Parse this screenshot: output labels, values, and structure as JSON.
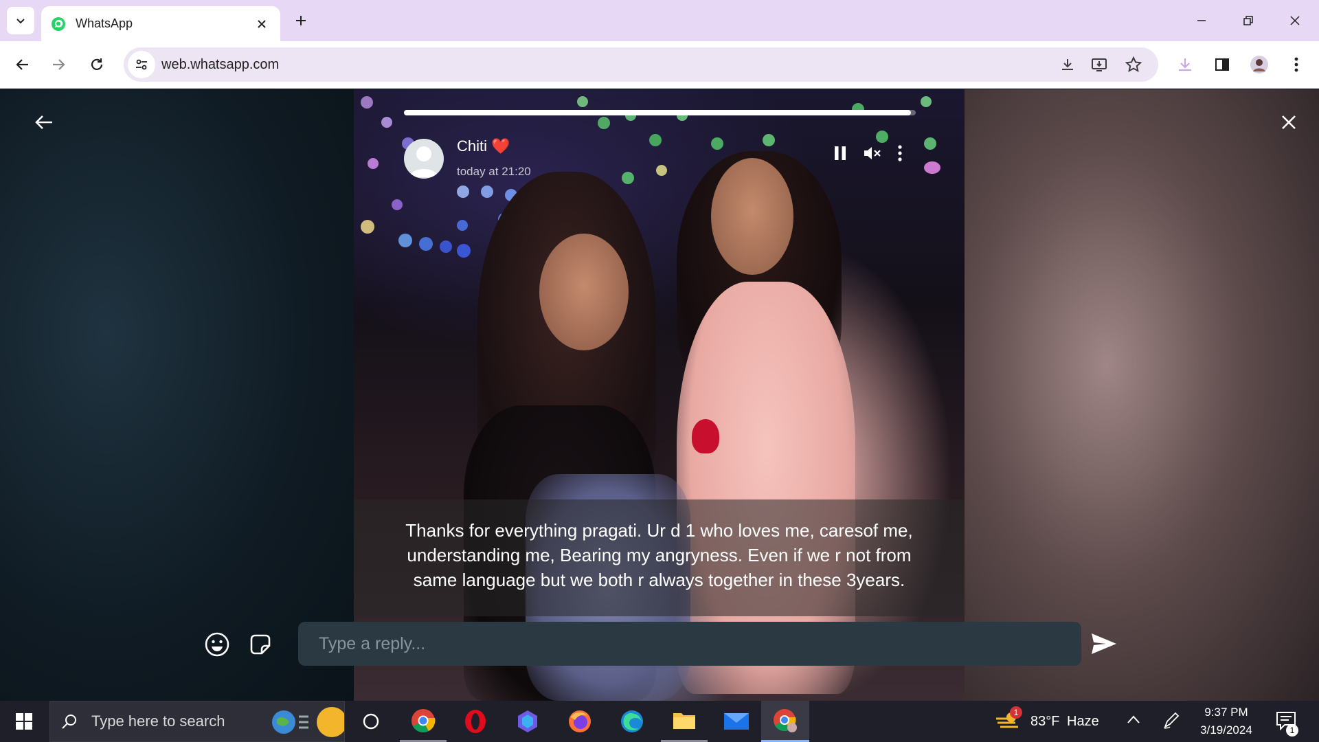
{
  "browser": {
    "tab_title": "WhatsApp",
    "url": "web.whatsapp.com",
    "accent": "#e7d8f5"
  },
  "status": {
    "contact_name": "Chiti",
    "name_emoji": "❤️",
    "time": "today at 21:20",
    "progress": 0.99,
    "caption": "Thanks for everything pragati. Ur d 1 who loves me, caresof me, understanding me, Bearing my angryness. Even if we r not from same language but we both r always together in these 3years.",
    "reply_placeholder": "Type a reply..."
  },
  "taskbar": {
    "search_placeholder": "Type here to search",
    "weather_temp": "83°F",
    "weather_desc": "Haze",
    "weather_badge": "1",
    "time": "9:37 PM",
    "date": "3/19/2024",
    "notification_count": "1"
  }
}
